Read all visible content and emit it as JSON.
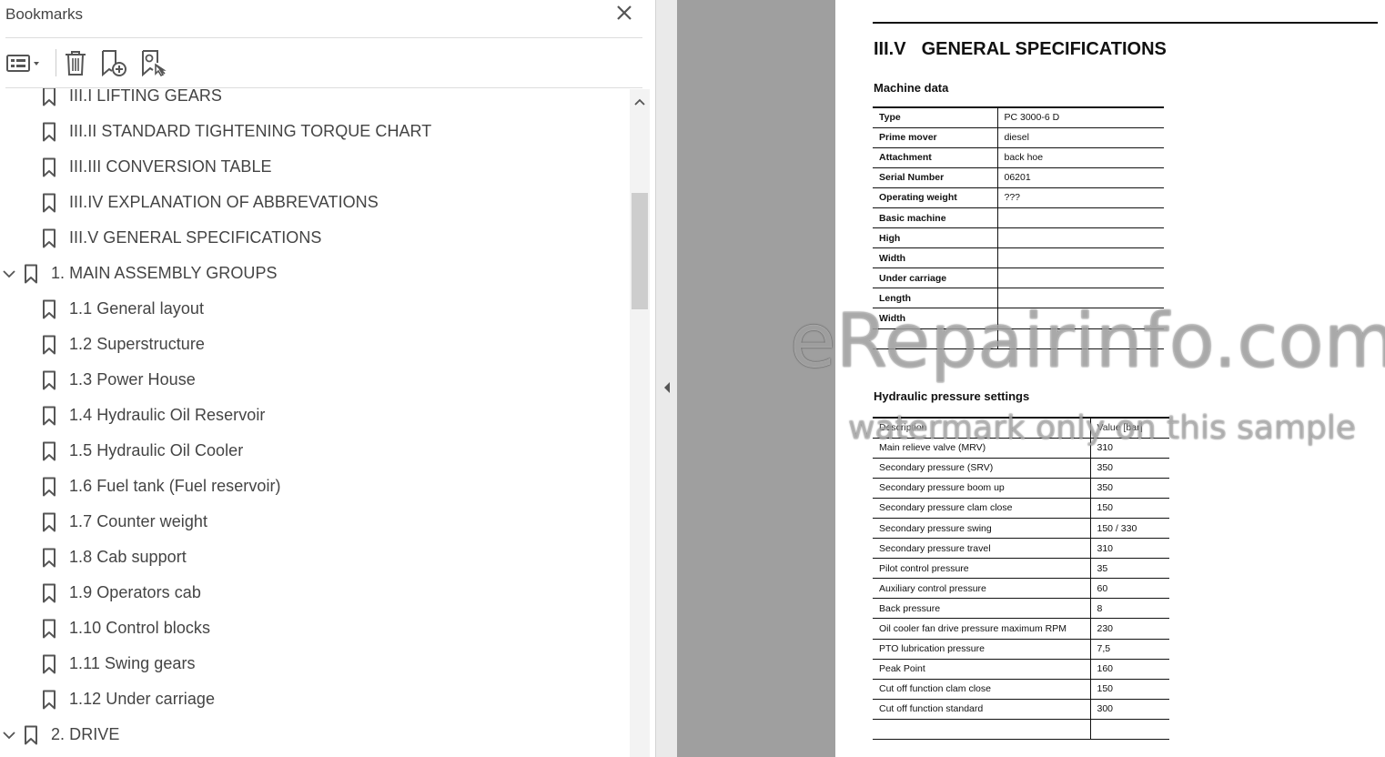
{
  "panel": {
    "title": "Bookmarks",
    "icons": {
      "close": "close-icon",
      "options": "options-menu-icon",
      "delete": "trash-icon",
      "new_bookmark": "new-bookmark-icon",
      "find_bookmark": "find-current-bookmark-icon"
    }
  },
  "bookmarks": [
    {
      "level": 1,
      "expanded": null,
      "label": "III.I LIFTING GEARS"
    },
    {
      "level": 1,
      "expanded": null,
      "label": "III.II STANDARD TIGHTENING TORQUE CHART"
    },
    {
      "level": 1,
      "expanded": null,
      "label": "III.III CONVERSION TABLE"
    },
    {
      "level": 1,
      "expanded": null,
      "label": "III.IV EXPLANATION OF ABBREVATIONS"
    },
    {
      "level": 1,
      "expanded": null,
      "label": "III.V GENERAL SPECIFICATIONS"
    },
    {
      "level": 0,
      "expanded": true,
      "label": "1. MAIN ASSEMBLY GROUPS"
    },
    {
      "level": 1,
      "expanded": null,
      "label": "1.1 General layout"
    },
    {
      "level": 1,
      "expanded": null,
      "label": "1.2 Superstructure"
    },
    {
      "level": 1,
      "expanded": null,
      "label": "1.3 Power House"
    },
    {
      "level": 1,
      "expanded": null,
      "label": "1.4 Hydraulic Oil Reservoir"
    },
    {
      "level": 1,
      "expanded": null,
      "label": "1.5 Hydraulic Oil Cooler"
    },
    {
      "level": 1,
      "expanded": null,
      "label": "1.6 Fuel tank (Fuel reservoir)"
    },
    {
      "level": 1,
      "expanded": null,
      "label": "1.7 Counter weight"
    },
    {
      "level": 1,
      "expanded": null,
      "label": "1.8 Cab support"
    },
    {
      "level": 1,
      "expanded": null,
      "label": "1.9 Operators cab"
    },
    {
      "level": 1,
      "expanded": null,
      "label": "1.10 Control blocks"
    },
    {
      "level": 1,
      "expanded": null,
      "label": "1.11 Swing gears"
    },
    {
      "level": 1,
      "expanded": null,
      "label": "1.12 Under carriage"
    },
    {
      "level": 0,
      "expanded": true,
      "label": "2. DRIVE"
    }
  ],
  "document": {
    "section_number": "III.V",
    "section_title": "GENERAL SPECIFICATIONS",
    "machine_heading": "Machine data",
    "machine_rows": [
      [
        "Type",
        "PC 3000-6 D"
      ],
      [
        "Prime mover",
        "diesel"
      ],
      [
        "Attachment",
        "back hoe"
      ],
      [
        "Serial Number",
        "06201"
      ],
      [
        "Operating weight",
        "???"
      ],
      [
        "Basic machine",
        ""
      ],
      [
        "High",
        ""
      ],
      [
        "Width",
        ""
      ],
      [
        "Under carriage",
        ""
      ],
      [
        "Length",
        ""
      ],
      [
        "Width",
        ""
      ],
      [
        "",
        ""
      ]
    ],
    "hydraulic_heading": "Hydraulic pressure settings",
    "hydraulic_header": [
      "Description",
      "Value [bar]"
    ],
    "hydraulic_rows": [
      [
        "Main relieve valve (MRV)",
        "310"
      ],
      [
        "Secondary pressure (SRV)",
        "350"
      ],
      [
        "Secondary pressure boom up",
        "350"
      ],
      [
        "Secondary pressure clam close",
        "150"
      ],
      [
        "Secondary pressure swing",
        "150 / 330"
      ],
      [
        "Secondary pressure travel",
        "310"
      ],
      [
        "Pilot control pressure",
        "35"
      ],
      [
        "Auxiliary control pressure",
        "60"
      ],
      [
        "Back pressure",
        "8"
      ],
      [
        "Oil cooler fan drive pressure maximum RPM",
        "230"
      ],
      [
        "PTO lubrication pressure",
        "7,5"
      ],
      [
        "Peak Point",
        "160"
      ],
      [
        "Cut off function clam close",
        "150"
      ],
      [
        "Cut off function standard",
        "300"
      ],
      [
        "",
        ""
      ]
    ]
  },
  "watermark": {
    "main": "eRepairinfo.com",
    "sub": "watermark only on this sample"
  }
}
